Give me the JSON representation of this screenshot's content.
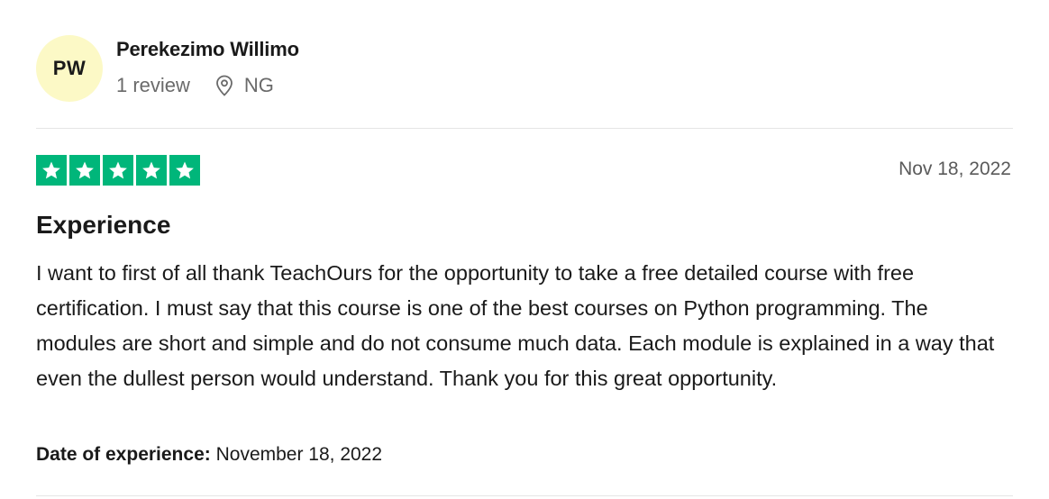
{
  "reviewer": {
    "initials": "PW",
    "name": "Perekezimo Willimo",
    "review_count": "1 review",
    "location": "NG",
    "avatar_color": "#fcf9c6"
  },
  "review": {
    "rating": 5,
    "max_rating": 5,
    "star_color": "#00b67a",
    "date": "Nov 18, 2022",
    "title": "Experience",
    "body": "I want to first of all thank TeachOurs for the opportunity to take a free detailed course with free certification. I must say that this course is one of the best courses on Python programming. The modules are short and simple and do not consume much data. Each module is explained in a way that even the dullest person would understand. Thank you for this great opportunity.",
    "date_of_experience_label": "Date of experience:",
    "date_of_experience": "November 18, 2022"
  },
  "icons": {
    "location": "location-pin-icon",
    "star": "star-icon"
  }
}
